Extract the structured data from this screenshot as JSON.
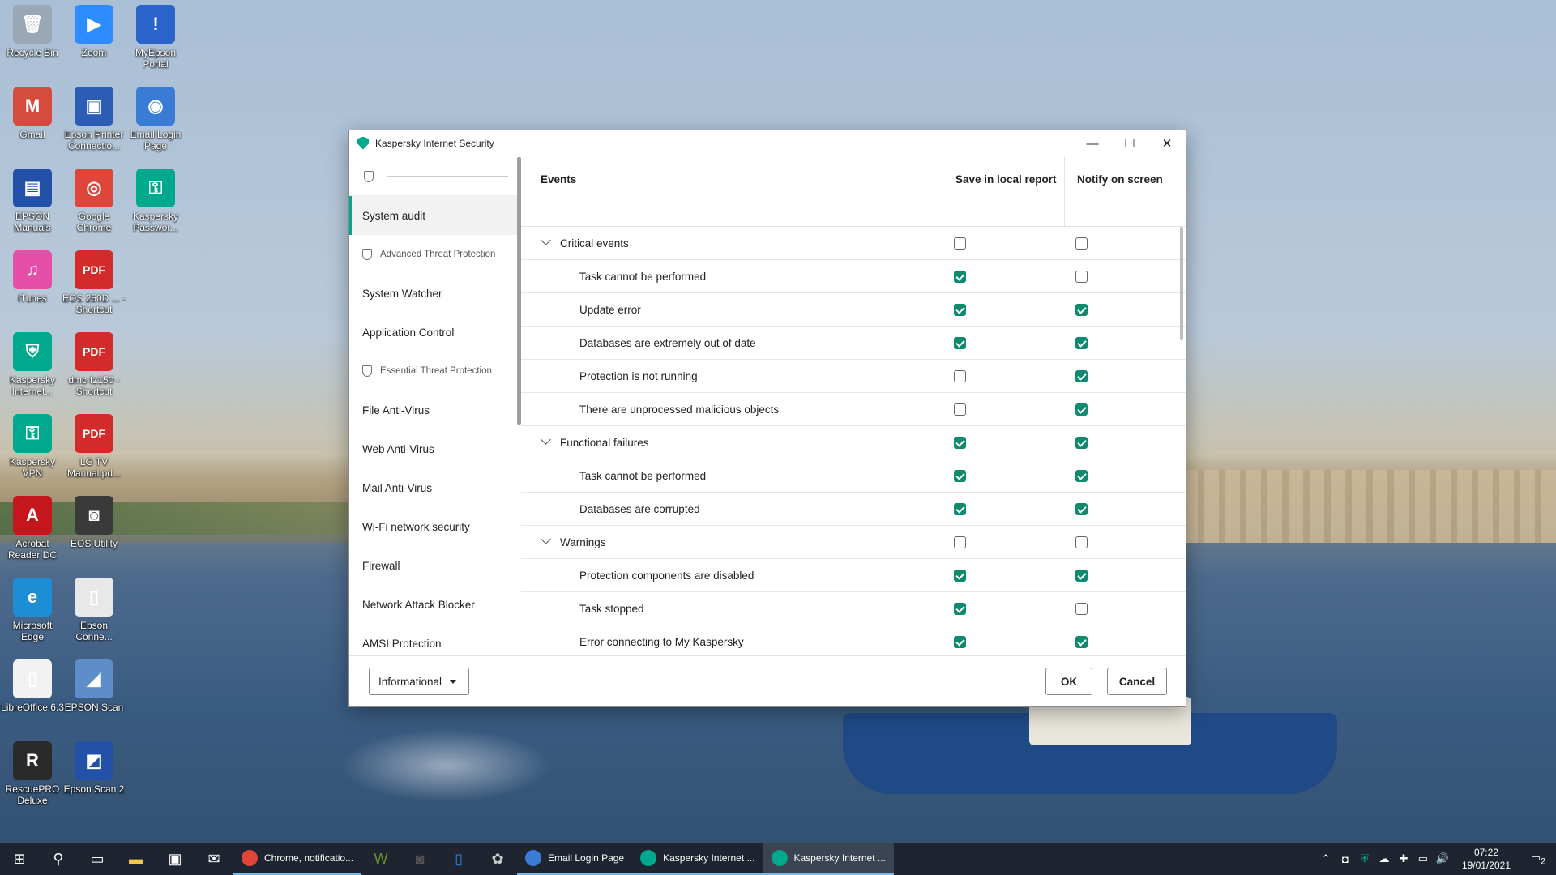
{
  "desktop": {
    "icons": [
      {
        "label": "Recycle Bin",
        "glyph": "🗑",
        "color": "#9aa7b5"
      },
      {
        "label": "Zoom",
        "glyph": "▶",
        "color": "#2d8cff"
      },
      {
        "label": "MyEpson Portal",
        "glyph": "!",
        "color": "#2a63c9"
      },
      {
        "label": "Gmail",
        "glyph": "M",
        "color": "#d54b3d"
      },
      {
        "label": "Epson Printer Connectio...",
        "glyph": "▣",
        "color": "#2b5db5"
      },
      {
        "label": "Email Login Page",
        "glyph": "◉",
        "color": "#3a7bd5"
      },
      {
        "label": "EPSON Manuals",
        "glyph": "▤",
        "color": "#2451a8"
      },
      {
        "label": "Google Chrome",
        "glyph": "◎",
        "color": "#e0453a"
      },
      {
        "label": "Kaspersky Passwor...",
        "glyph": "⚿",
        "color": "#00a88e"
      },
      {
        "label": "iTunes",
        "glyph": "♫",
        "color": "#e64fa8"
      },
      {
        "label": "EOS 250D ... - Shortcut",
        "glyph": "PDF",
        "color": "#d42a2a"
      },
      {
        "label": "Kaspersky Internet...",
        "glyph": "⛨",
        "color": "#00a88e"
      },
      {
        "label": "dmc-fz150 - Shortcut",
        "glyph": "PDF",
        "color": "#d42a2a"
      },
      {
        "label": "Kaspersky VPN",
        "glyph": "⚿",
        "color": "#00a88e"
      },
      {
        "label": "LG TV Manual.pd...",
        "glyph": "PDF",
        "color": "#d42a2a"
      },
      {
        "label": "Acrobat Reader DC",
        "glyph": "A",
        "color": "#c4161c"
      },
      {
        "label": "EOS Utility",
        "glyph": "◙",
        "color": "#3a3a3a"
      },
      {
        "label": "Microsoft Edge",
        "glyph": "e",
        "color": "#1d8ed6"
      },
      {
        "label": "Epson Conne...",
        "glyph": "▯",
        "color": "#e8e8e8"
      },
      {
        "label": "LibreOffice 6.3",
        "glyph": "▯",
        "color": "#f2f2f2"
      },
      {
        "label": "EPSON Scan",
        "glyph": "◢",
        "color": "#5d8ec9"
      },
      {
        "label": "RescuePRO Deluxe",
        "glyph": "R",
        "color": "#2a2a2a"
      },
      {
        "label": "Epson Scan 2",
        "glyph": "◩",
        "color": "#2451a8"
      }
    ]
  },
  "window": {
    "title": "Kaspersky Internet Security",
    "controls": {
      "minimize": "—",
      "maximize": "☐",
      "close": "✕"
    }
  },
  "sidebar": {
    "items": [
      {
        "type": "item",
        "label": "System audit",
        "active": true
      },
      {
        "type": "group",
        "label": "Advanced Threat Protection"
      },
      {
        "type": "item",
        "label": "System Watcher"
      },
      {
        "type": "item",
        "label": "Application Control"
      },
      {
        "type": "group",
        "label": "Essential Threat Protection"
      },
      {
        "type": "item",
        "label": "File Anti-Virus"
      },
      {
        "type": "item",
        "label": "Web Anti-Virus"
      },
      {
        "type": "item",
        "label": "Mail Anti-Virus"
      },
      {
        "type": "item",
        "label": "Wi-Fi network security"
      },
      {
        "type": "item",
        "label": "Firewall"
      },
      {
        "type": "item",
        "label": "Network Attack Blocker"
      },
      {
        "type": "item",
        "label": "AMSI Protection"
      }
    ]
  },
  "table": {
    "headers": {
      "events": "Events",
      "save": "Save in local report",
      "notify": "Notify on screen"
    },
    "rows": [
      {
        "kind": "cat",
        "label": "Critical events",
        "save": false,
        "notify": false
      },
      {
        "kind": "sub",
        "label": "Task cannot be performed",
        "save": true,
        "notify": false
      },
      {
        "kind": "sub",
        "label": "Update error",
        "save": true,
        "notify": true
      },
      {
        "kind": "sub",
        "label": "Databases are extremely out of date",
        "save": true,
        "notify": true
      },
      {
        "kind": "sub",
        "label": "Protection is not running",
        "save": false,
        "notify": true
      },
      {
        "kind": "sub",
        "label": "There are unprocessed malicious objects",
        "save": false,
        "notify": true
      },
      {
        "kind": "cat",
        "label": "Functional failures",
        "save": true,
        "notify": true
      },
      {
        "kind": "sub",
        "label": "Task cannot be performed",
        "save": true,
        "notify": true
      },
      {
        "kind": "sub",
        "label": "Databases are corrupted",
        "save": true,
        "notify": true
      },
      {
        "kind": "cat",
        "label": "Warnings",
        "save": false,
        "notify": false
      },
      {
        "kind": "sub",
        "label": "Protection components are disabled",
        "save": true,
        "notify": true
      },
      {
        "kind": "sub",
        "label": "Task stopped",
        "save": true,
        "notify": false
      },
      {
        "kind": "sub",
        "label": "Error connecting to My Kaspersky",
        "save": true,
        "notify": true
      }
    ]
  },
  "footer": {
    "level_select": "Informational",
    "ok_label": "OK",
    "cancel_label": "Cancel"
  },
  "taskbar": {
    "apps": [
      {
        "label": "Chrome, notificatio...",
        "color": "#e0453a",
        "active": false
      },
      {
        "label": "Email Login Page",
        "color": "#3a7bd5",
        "active": false
      },
      {
        "label": "Kaspersky Internet ...",
        "color": "#00a88e",
        "active": false
      },
      {
        "label": "Kaspersky Internet ...",
        "color": "#00a88e",
        "active": true
      }
    ],
    "time": "07:22",
    "date": "19/01/2021",
    "notification_count": "2"
  },
  "colors": {
    "accent": "#00a88e",
    "checked": "#0d8a6f"
  }
}
